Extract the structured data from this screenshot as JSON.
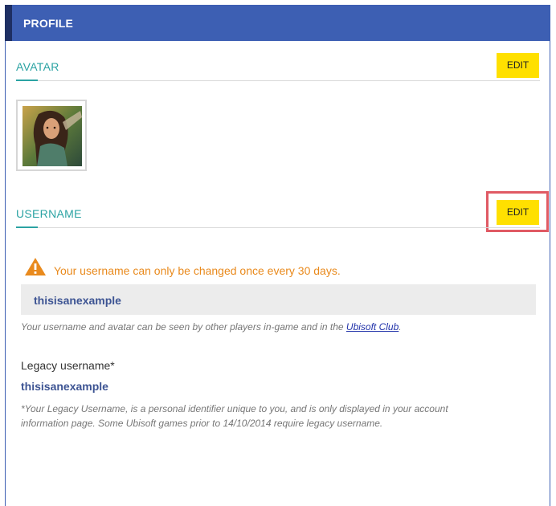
{
  "header": {
    "title": "PROFILE"
  },
  "avatar_section": {
    "label": "AVATAR",
    "edit_label": "EDIT"
  },
  "username_section": {
    "label": "USERNAME",
    "edit_label": "EDIT"
  },
  "warning": {
    "icon": "warning-triangle-icon",
    "text": "Your username can only be changed once every 30 days."
  },
  "username": {
    "value": "thisisanexample"
  },
  "visibility_note": {
    "text_before": "Your username and avatar can be seen by other players in-game and in the ",
    "link_text": "Ubisoft Club",
    "text_after": "."
  },
  "legacy": {
    "label": "Legacy username*",
    "value": "thisisanexample",
    "note_line1": "*Your Legacy Username, is a personal identifier unique to you, and is only displayed in your account",
    "note_line2": "information page. Some Ubisoft games prior to 14/10/2014 require legacy username."
  },
  "colors": {
    "header": "#3d5fb3",
    "accent": "#2ba3a3",
    "edit_button": "#ffe000",
    "warning": "#e98a1d",
    "highlight": "#e05a64"
  }
}
